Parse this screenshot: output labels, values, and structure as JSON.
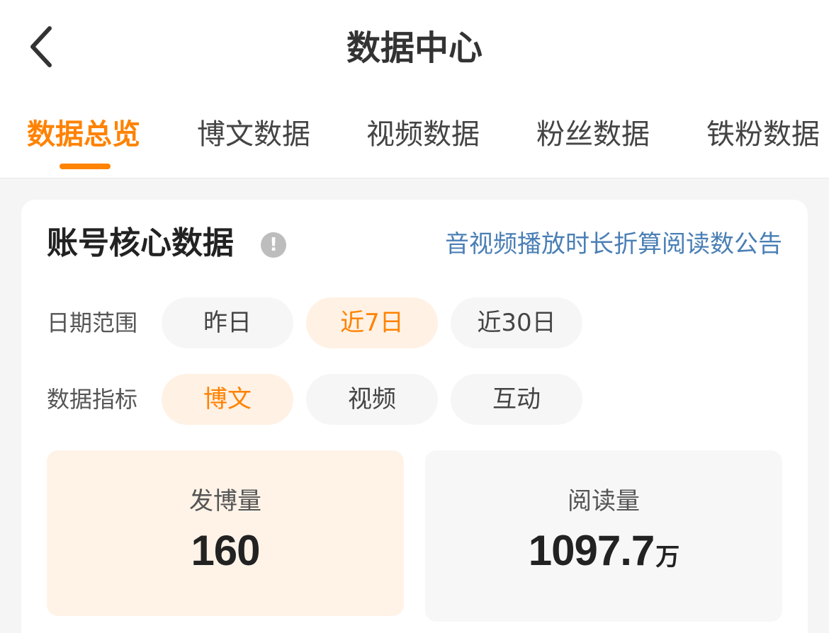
{
  "header": {
    "title": "数据中心"
  },
  "tabs": [
    {
      "label": "数据总览",
      "active": true
    },
    {
      "label": "博文数据",
      "active": false
    },
    {
      "label": "视频数据",
      "active": false
    },
    {
      "label": "粉丝数据",
      "active": false
    },
    {
      "label": "铁粉数据",
      "active": false
    }
  ],
  "card": {
    "title": "账号核心数据",
    "info_icon": "!",
    "notice_link": "音视频播放时长折算阅读数公告",
    "date_range": {
      "label": "日期范围",
      "options": [
        "昨日",
        "近7日",
        "近30日"
      ],
      "selected": "近7日"
    },
    "metric": {
      "label": "数据指标",
      "options": [
        "博文",
        "视频",
        "互动"
      ],
      "selected": "博文"
    },
    "stats": [
      {
        "label": "发博量",
        "value": "160",
        "unit": ""
      },
      {
        "label": "阅读量",
        "value": "1097.7",
        "unit": "万"
      }
    ]
  },
  "colors": {
    "accent": "#ff8200",
    "link": "#4a7fb5",
    "chip_active_bg": "#fff1e4"
  }
}
